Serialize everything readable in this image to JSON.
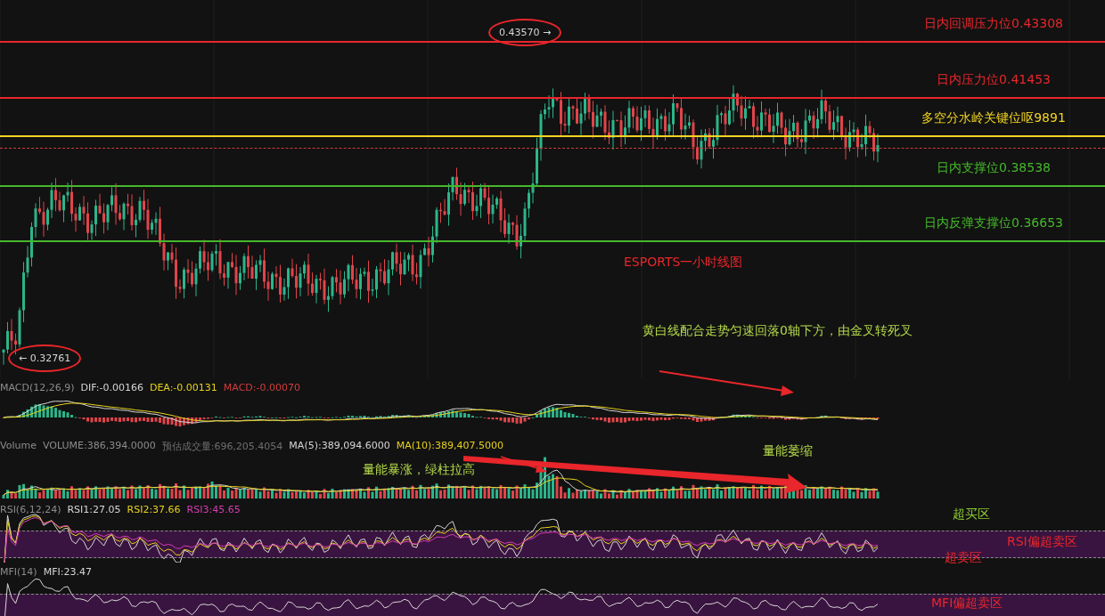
{
  "main_chart": {
    "title": "ESPORTS一小时线图",
    "levels": [
      {
        "label": "日内回调压力位0.43308",
        "color": "#e8262b"
      },
      {
        "label": "日内压力位0.41453",
        "color": "#e8262b"
      },
      {
        "label": "多空分水岭关键位呕9891",
        "color": "#f2d522"
      },
      {
        "label": "日内支撑位0.38538",
        "color": "#45b82a"
      },
      {
        "label": "日内反弹支撑位0.36653",
        "color": "#45b82a"
      }
    ],
    "high_label": "0.43570 →",
    "low_label": "← 0.32761",
    "note": "黄白线配合走势匀速回落0轴下方，由金叉转死叉"
  },
  "macd": {
    "name": "MACD(12,26,9)",
    "values": [
      {
        "text": "DIF:-0.00166",
        "color": "#d6d6d6"
      },
      {
        "text": "DEA:-0.00131",
        "color": "#e8d21c"
      },
      {
        "text": "MACD:-0.00070",
        "color": "#d23c3c"
      }
    ]
  },
  "volume": {
    "name": "Volume",
    "values": [
      {
        "text": "VOLUME:386,394.0000",
        "color": "#8c8c8c"
      },
      {
        "text": "预估成交量:696,205.4054",
        "color": "#6f6f6f"
      },
      {
        "text": "MA(5):389,094.6000",
        "color": "#d6d6d6"
      },
      {
        "text": "MA(10):389,407.5000",
        "color": "#e8d21c"
      }
    ],
    "note": "量能暴涨，绿柱拉高",
    "note_2": "量能萎缩"
  },
  "rsi": {
    "name": "RSI(6,12,24)",
    "values": [
      {
        "text": "RSI1:27.05",
        "color": "#d6d6d6"
      },
      {
        "text": "RSI2:37.66",
        "color": "#e8d21c"
      },
      {
        "text": "RSI3:45.65",
        "color": "#d63cb4"
      }
    ],
    "overbought_label": "超买区",
    "oversold_label": "超卖区",
    "zone_label": "RSI偏超卖区"
  },
  "mfi": {
    "name": "MFI(14)",
    "values": [
      {
        "text": "MFI:23.47",
        "color": "#d6d6d6"
      }
    ],
    "zone_label": "MFI偏超卖区"
  }
}
